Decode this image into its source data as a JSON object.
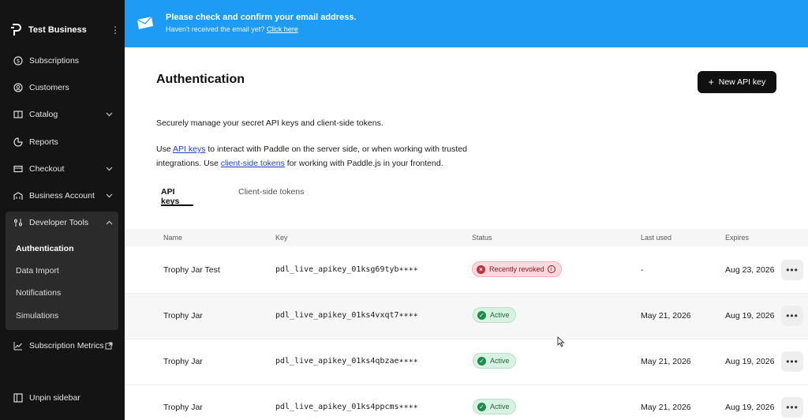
{
  "sidebar": {
    "business_name": "Test Business",
    "items": [
      {
        "label": "Subscriptions",
        "icon": "subscriptions-icon"
      },
      {
        "label": "Customers",
        "icon": "customers-icon"
      },
      {
        "label": "Catalog",
        "icon": "catalog-icon"
      },
      {
        "label": "Reports",
        "icon": "reports-icon"
      },
      {
        "label": "Checkout",
        "icon": "checkout-icon"
      },
      {
        "label": "Business Account",
        "icon": "business-account-icon"
      },
      {
        "label": "Developer Tools",
        "icon": "developer-tools-icon"
      }
    ],
    "developer_tools_sub": [
      "Authentication",
      "Data Import",
      "Notifications",
      "Simulations"
    ],
    "subscription_metrics": "Subscription Metrics",
    "unpin": "Unpin sidebar"
  },
  "banner": {
    "title": "Please check and confirm your email address.",
    "subtitle": "Haven't received the email yet?",
    "link": "Click here"
  },
  "page": {
    "title": "Authentication",
    "new_key_button": "New API key",
    "description": "Securely manage your secret API keys and client-side tokens.",
    "usage_pre": "Use ",
    "usage_link1": "API keys",
    "usage_mid": " to interact with Paddle on the server side, or when working with trusted integrations. Use ",
    "usage_link2": "client-side tokens",
    "usage_post": " for working with Paddle.js in your frontend."
  },
  "tabs": [
    "API keys",
    "Client-side tokens"
  ],
  "table": {
    "columns": [
      "Name",
      "Key",
      "Status",
      "Last used",
      "Expires"
    ],
    "rows": [
      {
        "name": "Trophy Jar Test",
        "key": "pdl_live_apikey_01ksg69tyb∗∗∗∗",
        "status": "Recently revoked",
        "last_used": "-",
        "expires": "Aug 23, 2026"
      },
      {
        "name": "Trophy Jar",
        "key": "pdl_live_apikey_01ks4vxqt7∗∗∗∗",
        "status": "Active",
        "last_used": "May 21, 2026",
        "expires": "Aug 19, 2026"
      },
      {
        "name": "Trophy Jar",
        "key": "pdl_live_apikey_01ks4qbzae∗∗∗∗",
        "status": "Active",
        "last_used": "May 21, 2026",
        "expires": "Aug 19, 2026"
      },
      {
        "name": "Trophy Jar",
        "key": "pdl_live_apikey_01ks4ppcms∗∗∗∗",
        "status": "Active",
        "last_used": "May 21, 2026",
        "expires": "Aug 19, 2026"
      }
    ],
    "more_label": "•••"
  },
  "colors": {
    "sidebar_bg": "#141414",
    "banner_bg": "#1d9bf5",
    "revoked": "#c0303b",
    "active": "#1f8a4a"
  }
}
